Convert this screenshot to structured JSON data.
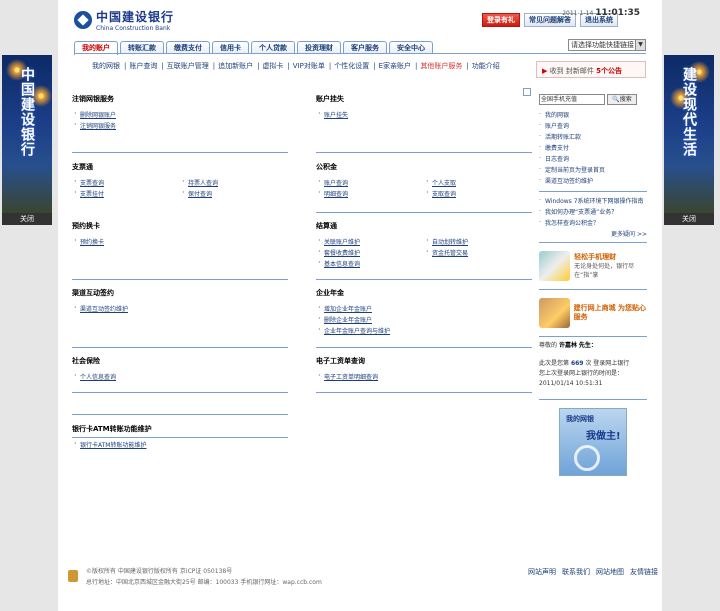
{
  "header": {
    "logo_cn": "中国建设银行",
    "logo_en": "China Construction Bank",
    "btn_promo": "登录有礼",
    "btn_faq": "常见问题解答",
    "btn_exit": "退出系统",
    "date": "2011-1-14",
    "time": "11:01:35"
  },
  "nav": {
    "tabs": [
      "我的账户",
      "转账汇款",
      "缴费支付",
      "信用卡",
      "个人贷款",
      "投资理财",
      "客户服务",
      "安全中心"
    ],
    "quick_select": "请选择功能快捷链接",
    "subnav": [
      "我的网银",
      "账户查询",
      "互联账户管理",
      "追加新账户",
      "虚拟卡",
      "VIP对账单",
      "个性化设置",
      "E家亲账户",
      "其他账户服务",
      "功能介绍"
    ],
    "subnav_sep": "|"
  },
  "messages": {
    "prefix": "收到",
    "mid": "封新邮件",
    "count": "5个公告"
  },
  "sections": [
    {
      "title": "注销网银服务",
      "items": [
        "删除网银账户",
        "注销网银服务"
      ]
    },
    {
      "title": "账户挂失",
      "items": [
        "账户挂失"
      ]
    },
    {
      "title": "支票通",
      "items": [
        "支票查询",
        "持票人查询",
        "支票挂付",
        "保付查询"
      ]
    },
    {
      "title": "公积金",
      "items": [
        "账户查询",
        "个人支取",
        "明细查询",
        "支取查询"
      ]
    },
    {
      "title": "预约换卡",
      "items": [
        "预约换卡"
      ]
    },
    {
      "title": "结算通",
      "items": [
        "关联账户维护",
        "自动划转维护",
        "套餐收费维护",
        "资金托管交易",
        "基本信息查询"
      ]
    },
    {
      "title": "渠道互动签约",
      "items": [
        "渠道互动签约维护"
      ]
    },
    {
      "title": "企业年金",
      "items": [
        "增加企业年金账户",
        "删除企业年金账户",
        "企业年金账户查询与维护"
      ]
    },
    {
      "title": "社会保险",
      "items": [
        "个人信息查询"
      ]
    },
    {
      "title": "电子工资单查询",
      "items": [
        "电子工资单明细查询"
      ]
    },
    {
      "title": "银行卡ATM转账功能维护",
      "items": [
        "银行卡ATM转账功能维护"
      ]
    }
  ],
  "right": {
    "search_value": "全国手机充值",
    "search_btn": "搜索",
    "links": [
      "我的网银",
      "账户查询",
      "活期转账汇款",
      "缴费支付",
      "日志查询",
      "定制当前页为登录首页",
      "渠道互动签约维护"
    ],
    "help": [
      "Windows 7系统环境下网银操作指南",
      "我如何办理“支票通”业务？",
      "我怎样查询公积金？"
    ],
    "more": "更多疑问 >>",
    "promo1_title": "轻松手机理财",
    "promo1_sub": "无论身处何处，银行尽在“指”掌",
    "promo2_title": "建行网上商城 为您贴心服务",
    "greet_prefix": "尊敬的",
    "greet_name": "许嘉林",
    "greet_suffix": "先生：",
    "visit_text1": "此次是您第",
    "visit_count": "669",
    "visit_text2": "次 登录网上银行",
    "last_login_label": "您上次登录网上银行的时间是：",
    "last_login": "2011/01/14 10:51:31",
    "card_l1": "我的网银",
    "card_l2": "我做主!"
  },
  "footer": {
    "line1": "©版权所有 中国建设银行版权所有 京ICP证 050138号",
    "line2": "总行地址：中国北京西城区金融大街25号 邮编：100033 手机银行网址：wap.ccb.com",
    "links": [
      "网站声明",
      "联系我们",
      "网站地图",
      "友情链接"
    ]
  },
  "banners": {
    "left_text": "中国建设银行",
    "right_text": "建设现代生活",
    "close": "关闭"
  },
  "colors": {
    "brand": "#1b3a8a",
    "rule": "#7d9fd1",
    "link": "#1d3f7a",
    "alert": "#cc0000"
  }
}
